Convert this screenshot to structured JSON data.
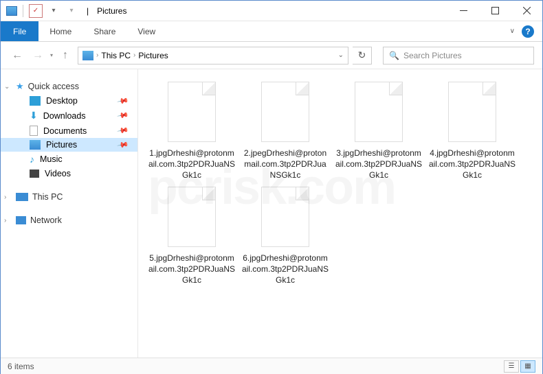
{
  "titlebar": {
    "title": "Pictures",
    "separator": "|"
  },
  "ribbon": {
    "file": "File",
    "tabs": [
      "Home",
      "Share",
      "View"
    ]
  },
  "nav": {
    "breadcrumb": [
      "This PC",
      "Pictures"
    ],
    "search_placeholder": "Search Pictures"
  },
  "sidebar": {
    "quick_access": "Quick access",
    "items": [
      {
        "label": "Desktop",
        "icon": "desk",
        "pinned": true
      },
      {
        "label": "Downloads",
        "icon": "dl",
        "pinned": true
      },
      {
        "label": "Documents",
        "icon": "doc",
        "pinned": true
      },
      {
        "label": "Pictures",
        "icon": "pic",
        "pinned": true,
        "selected": true
      },
      {
        "label": "Music",
        "icon": "mus",
        "pinned": false
      },
      {
        "label": "Videos",
        "icon": "vid",
        "pinned": false
      }
    ],
    "this_pc": "This PC",
    "network": "Network"
  },
  "files": [
    {
      "name": "1.jpgDrheshi@protonmail.com.3tp2PDRJuaNSGk1c"
    },
    {
      "name": "2.jpegDrheshi@protonmail.com.3tp2PDRJuaNSGk1c"
    },
    {
      "name": "3.jpgDrheshi@protonmail.com.3tp2PDRJuaNSGk1c"
    },
    {
      "name": "4.jpgDrheshi@protonmail.com.3tp2PDRJuaNSGk1c"
    },
    {
      "name": "5.jpgDrheshi@protonmail.com.3tp2PDRJuaNSGk1c"
    },
    {
      "name": "6.jpgDrheshi@protonmail.com.3tp2PDRJuaNSGk1c"
    }
  ],
  "status": {
    "text": "6 items"
  }
}
